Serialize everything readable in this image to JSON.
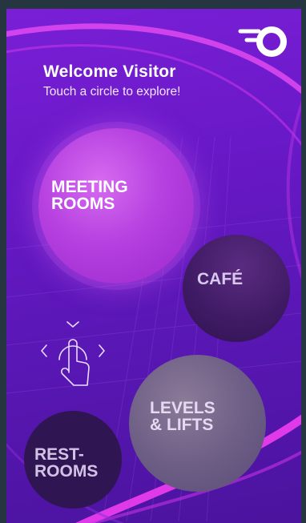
{
  "header": {
    "welcome": "Welcome Visitor",
    "subtitle": "Touch a circle to explore!"
  },
  "circles": {
    "meeting": {
      "line1": "MEETING",
      "line2": "ROOMS"
    },
    "cafe": {
      "line1": "CAFÉ"
    },
    "levels": {
      "line1": "LEVELS",
      "line2": "& LIFTS"
    },
    "rest": {
      "line1": "REST-",
      "line2": "ROOMS"
    }
  },
  "icons": {
    "logo": "brand-logo-icon",
    "touch": "touch-hand-icon"
  },
  "colors": {
    "background_top": "#7a1fd6",
    "background_bottom": "#4b139e",
    "accent_magenta": "#e02fe0",
    "meeting_circle": "#b640e0",
    "cafe_circle": "#3e1a63",
    "levels_circle": "#6e5f86",
    "rest_circle": "#301553"
  }
}
